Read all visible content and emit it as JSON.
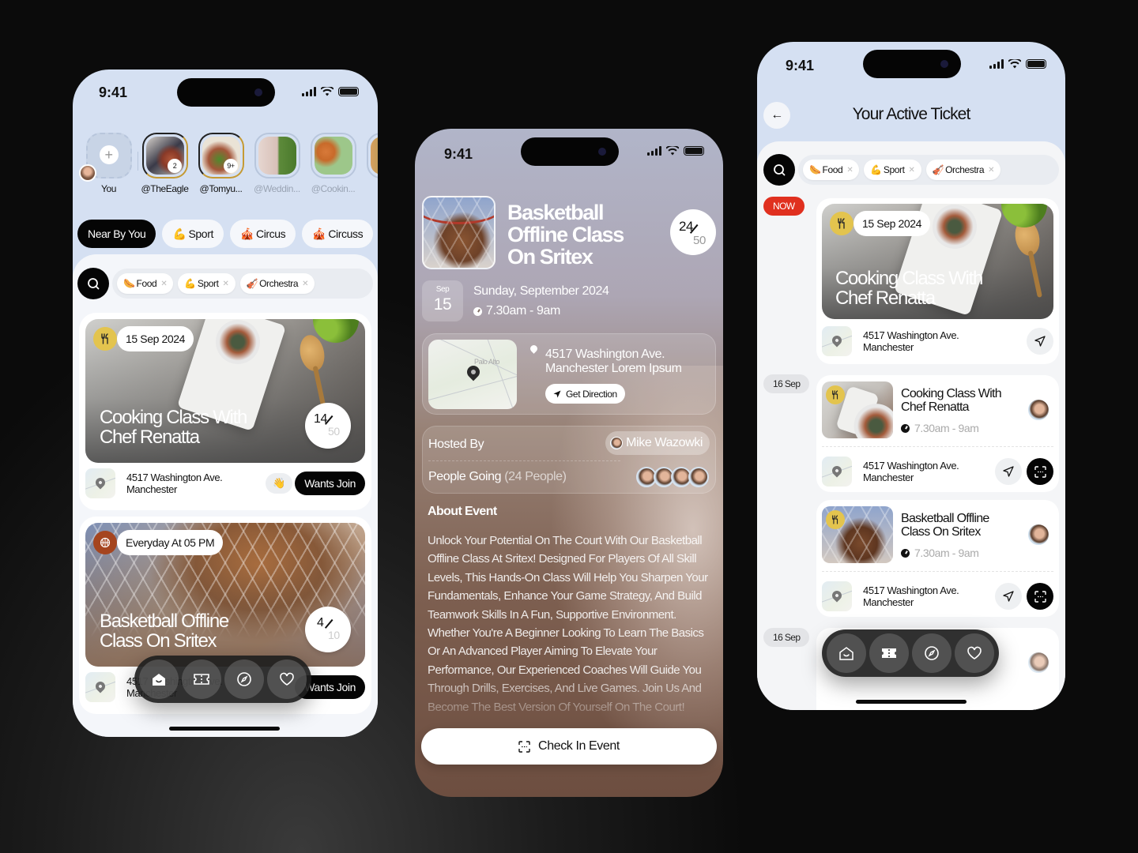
{
  "status": {
    "time": "9:41"
  },
  "home": {
    "stories": [
      {
        "label": "You",
        "type": "add"
      },
      {
        "label": "@TheEagle",
        "badge": "2",
        "active": true
      },
      {
        "label": "@Tomyu...",
        "badge": "9+",
        "active": true
      },
      {
        "label": "@Weddin...",
        "active": false
      },
      {
        "label": "@Cookin...",
        "active": false
      }
    ],
    "categories": [
      {
        "label": "Near By You",
        "icon": ""
      },
      {
        "label": "Sport",
        "icon": "💪"
      },
      {
        "label": "Circus",
        "icon": "🎪"
      },
      {
        "label": "Circuss",
        "icon": "🎪"
      }
    ],
    "filters": [
      {
        "label": "Food",
        "icon": "🌭"
      },
      {
        "label": "Sport",
        "icon": "💪"
      },
      {
        "label": "Orchestra",
        "icon": "🎻"
      }
    ],
    "events": [
      {
        "date": "15 Sep 2024",
        "title": "Cooking Class With Chef Renatta",
        "joined": "14",
        "capacity": "50",
        "address_line1": "4517 Washington Ave.",
        "address_line2": "Manchester",
        "wave": "👋",
        "action": "Wants Join",
        "category": "food"
      },
      {
        "date": "Everyday At  05 PM",
        "title": "Basketball Offline Class On Sritex",
        "joined": "4",
        "capacity": "10",
        "address_line1": "4517 Washington Ave.",
        "address_line2": "Manchester",
        "action": "Wants Join",
        "category": "basketball"
      }
    ]
  },
  "detail": {
    "title": "Basketball Offline Class On Sritex",
    "joined": "24",
    "capacity": "50",
    "month": "Sep",
    "day": "15",
    "date_full": "Sunday, September 2024",
    "time": "7.30am - 9am",
    "map_label": "Palo Alto",
    "address": "4517 Washington Ave. Manchester Lorem Ipsum",
    "get_direction": "Get Direction",
    "hosted_by_label": "Hosted By",
    "host_name": "Mike Wazowki",
    "people_going_label": "People Going",
    "people_going_count": "(24 People)",
    "about_heading": "About Event",
    "about_text": "Unlock Your Potential On The Court With Our Basketball Offline Class At Sritex! Designed For Players Of All Skill Levels, This Hands-On Class Will Help You Sharpen Your Fundamentals, Enhance Your Game Strategy, And Build Teamwork Skills In A Fun, Supportive Environment. Whether You're A Beginner Looking To Learn The Basics Or An Advanced Player Aiming To Elevate Your Performance, Our Experienced Coaches Will Guide You Through Drills, Exercises, And Live Games. Join Us And Become The Best Version Of Yourself On The Court!",
    "check_in": "Check In Event"
  },
  "tickets": {
    "title": "Your Active Ticket",
    "filters": [
      {
        "label": "Food",
        "icon": "🌭"
      },
      {
        "label": "Sport",
        "icon": "💪"
      },
      {
        "label": "Orchestra",
        "icon": "🎻"
      }
    ],
    "groups": [
      {
        "day": "NOW",
        "date": "15 Sep 2024",
        "title": "Cooking Class With Chef Renatta",
        "address_line1": "4517 Washington Ave.",
        "address_line2": "Manchester"
      },
      {
        "day": "16 Sep",
        "title": "Cooking Class With Chef Renatta",
        "time": "7.30am - 9am",
        "address_line1": "4517 Washington Ave.",
        "address_line2": "Manchester"
      },
      {
        "day": "",
        "title": "Basketball Offline Class On Sritex",
        "time": "7.30am - 9am",
        "address_line1": "4517 Washington Ave.",
        "address_line2": "Manchester"
      },
      {
        "day": "16 Sep"
      }
    ]
  },
  "nav": {
    "items": [
      "home",
      "ticket",
      "explore",
      "favorites"
    ]
  },
  "colors": {
    "accent_now": "#e0301f",
    "food_badge": "#e3c44e",
    "sport_badge": "#a5451f",
    "dark": "#050505"
  }
}
